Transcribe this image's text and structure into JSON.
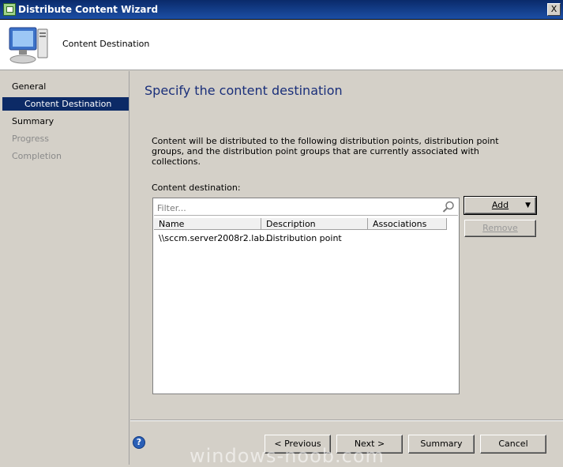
{
  "window": {
    "title": "Distribute Content Wizard",
    "close_label": "X"
  },
  "header": {
    "title": "Content Destination",
    "icon": "computer-icon"
  },
  "nav": {
    "general": "General",
    "content_destination": "Content Destination",
    "summary": "Summary",
    "progress": "Progress",
    "completion": "Completion"
  },
  "main": {
    "title": "Specify the content destination",
    "description": "Content will be distributed to the following distribution points, distribution point groups, and the distribution point groups that are currently associated with collections.",
    "destination_label": "Content destination:",
    "filter_placeholder": "Filter...",
    "columns": [
      "Name",
      "Description",
      "Associations"
    ],
    "rows": [
      {
        "name": "\\\\sccm.server2008r2.lab...",
        "description": "Distribution point",
        "associations": ""
      }
    ],
    "add_label": "Add",
    "remove_label": "Remove"
  },
  "footer": {
    "previous_label": "< Previous",
    "next_label": "Next >",
    "summary_label": "Summary",
    "cancel_label": "Cancel",
    "help_label": "?"
  },
  "watermark": "windows-noob.com",
  "colors": {
    "title_accent": "#1a2f7a",
    "nav_selected": "#0c2a66"
  }
}
